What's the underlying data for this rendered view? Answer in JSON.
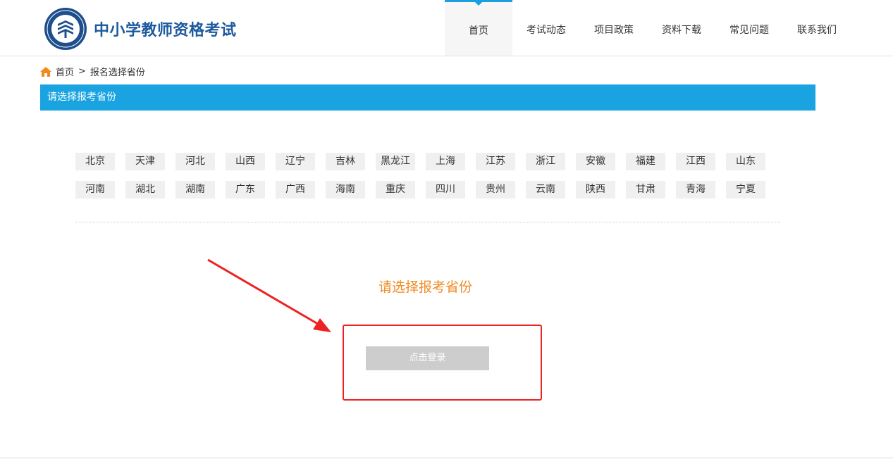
{
  "header": {
    "site_title": "中小学教师资格考试",
    "nav": [
      {
        "label": "首页",
        "active": true
      },
      {
        "label": "考试动态",
        "active": false
      },
      {
        "label": "项目政策",
        "active": false
      },
      {
        "label": "资料下载",
        "active": false
      },
      {
        "label": "常见问题",
        "active": false
      },
      {
        "label": "联系我们",
        "active": false
      }
    ]
  },
  "breadcrumb": {
    "home": "首页",
    "separator": ">",
    "current": "报名选择省份"
  },
  "section": {
    "title": "请选择报考省份"
  },
  "provinces": {
    "row1": [
      "北京",
      "天津",
      "河北",
      "山西",
      "辽宁",
      "吉林",
      "黑龙江",
      "上海",
      "江苏",
      "浙江",
      "安徽",
      "福建",
      "江西",
      "山东"
    ],
    "row2": [
      "河南",
      "湖北",
      "湖南",
      "广东",
      "广西",
      "海南",
      "重庆",
      "四川",
      "贵州",
      "云南",
      "陕西",
      "甘肃",
      "青海",
      "宁夏"
    ]
  },
  "main": {
    "prompt": "请选择报考省份",
    "login_button": "点击登录"
  },
  "colors": {
    "brand_blue": "#1e5a9e",
    "section_bar": "#1aa3e1",
    "prompt_orange": "#ef8b26",
    "annotation_red": "#ee2222"
  }
}
